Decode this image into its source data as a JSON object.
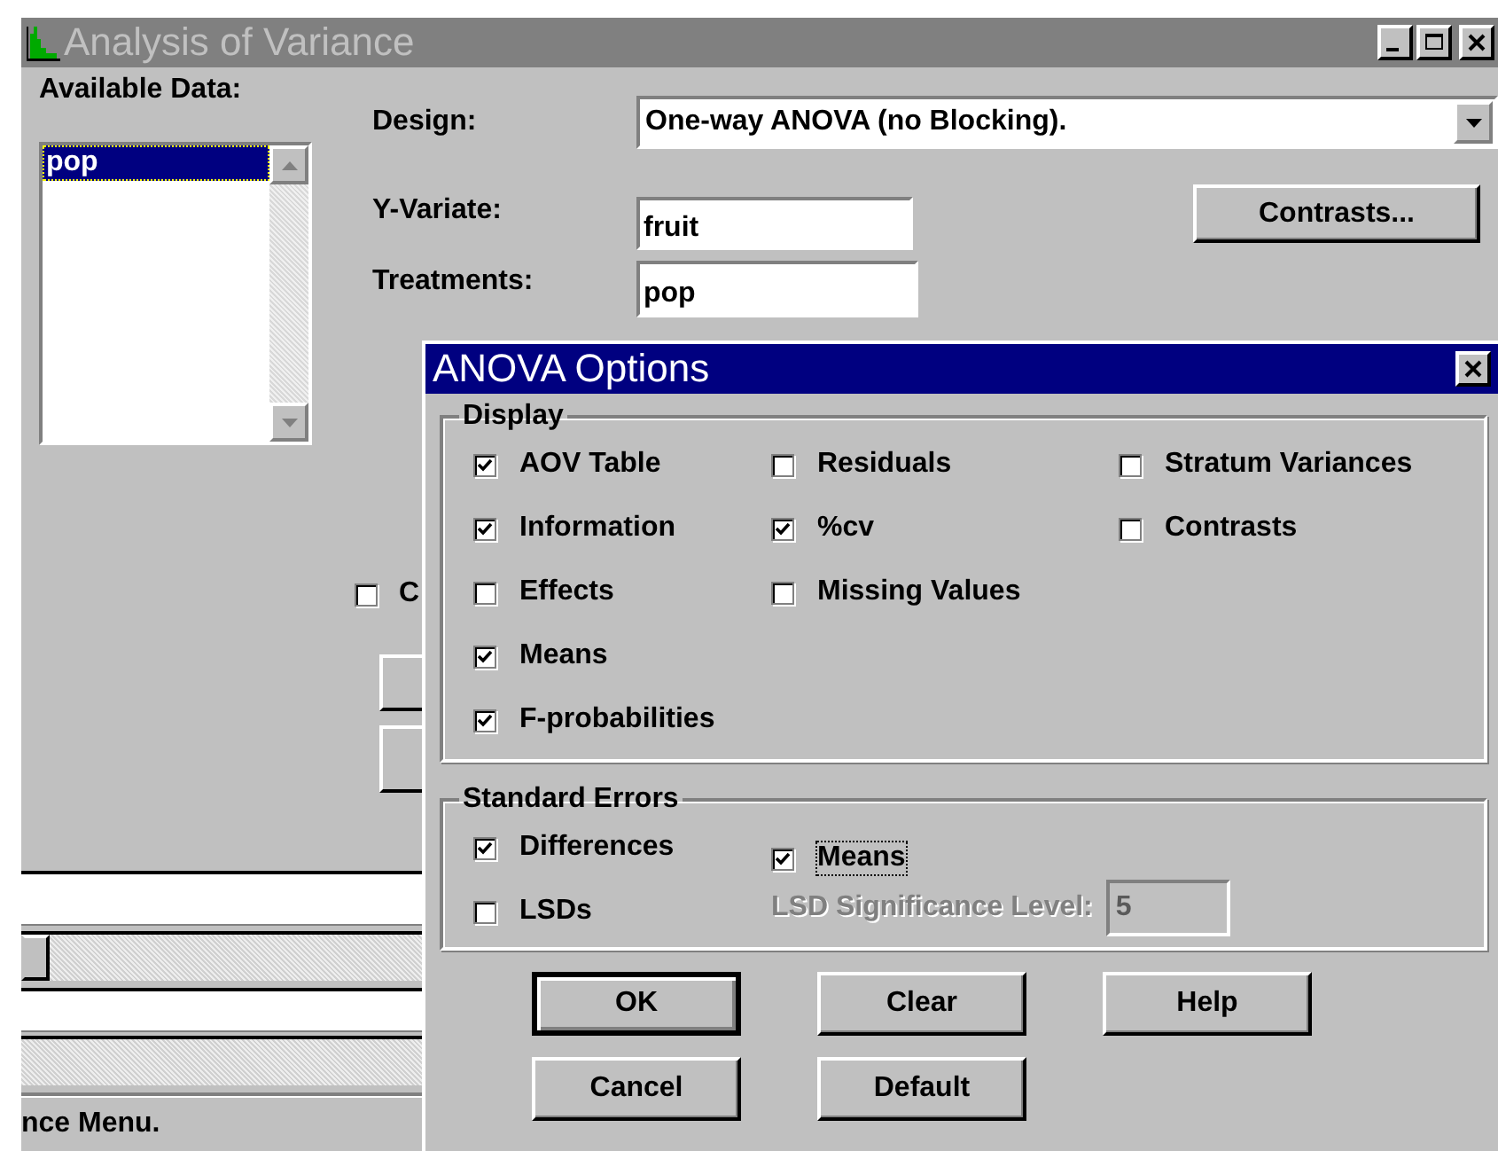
{
  "main_window": {
    "title": "Analysis of Variance",
    "active": false,
    "available_data": {
      "label": "Available Data:",
      "items": [
        {
          "label": "pop",
          "selected": true
        }
      ]
    },
    "design": {
      "label": "Design:",
      "value": "One-way ANOVA (no Blocking)."
    },
    "y_variate": {
      "label": "Y-Variate:",
      "value": "fruit"
    },
    "treatments": {
      "label": "Treatments:",
      "value": "pop"
    },
    "contrasts_button": "Contrasts...",
    "partial_checkbox": {
      "label": "C",
      "checked": false
    },
    "status_bar": "nce Menu."
  },
  "dialog": {
    "title": "ANOVA Options",
    "active": true,
    "display": {
      "title": "Display",
      "columns": [
        [
          {
            "label": "AOV Table",
            "checked": true
          },
          {
            "label": "Information",
            "checked": true
          },
          {
            "label": "Effects",
            "checked": false
          },
          {
            "label": "Means",
            "checked": true
          },
          {
            "label": "F-probabilities",
            "checked": true
          }
        ],
        [
          {
            "label": "Residuals",
            "checked": false
          },
          {
            "label": "%cv",
            "checked": true
          },
          {
            "label": "Missing Values",
            "checked": false
          }
        ],
        [
          {
            "label": "Stratum Variances",
            "checked": false
          },
          {
            "label": "Contrasts",
            "checked": false
          }
        ]
      ]
    },
    "standard_errors": {
      "title": "Standard Errors",
      "columns": [
        [
          {
            "label": "Differences",
            "checked": true,
            "focused": false
          },
          {
            "label": "LSDs",
            "checked": false,
            "focused": false
          }
        ],
        [
          {
            "label": "Means",
            "checked": true,
            "focused": true
          }
        ]
      ],
      "lsd_level": {
        "label": "LSD Significance Level:",
        "value": "5",
        "disabled": true
      }
    },
    "buttons": [
      {
        "label": "OK",
        "default": true
      },
      {
        "label": "Clear",
        "default": false
      },
      {
        "label": "Help",
        "default": false
      },
      {
        "label": "Cancel",
        "default": false
      },
      {
        "label": "Default",
        "default": false
      }
    ]
  }
}
